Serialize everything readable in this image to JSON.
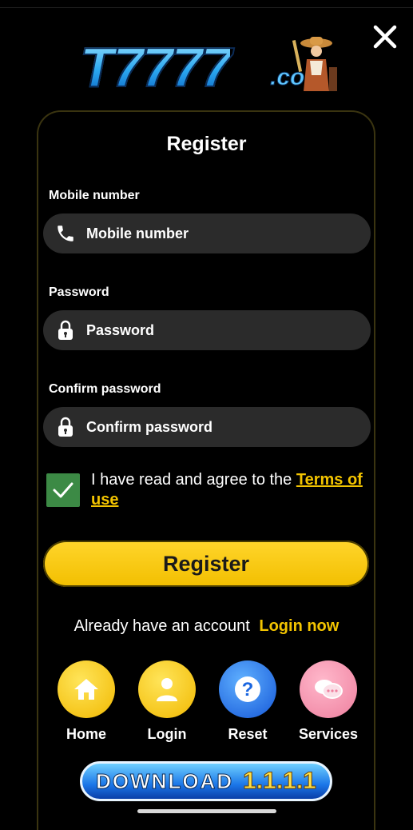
{
  "logo": {
    "main": "T7777",
    "suffix": ".com"
  },
  "form": {
    "title": "Register",
    "mobile": {
      "label": "Mobile number",
      "placeholder": "Mobile number"
    },
    "password": {
      "label": "Password",
      "placeholder": "Password"
    },
    "confirm": {
      "label": "Confirm password",
      "placeholder": "Confirm password"
    },
    "agree_text": "I have read and agree to the ",
    "terms_link": "Terms of use",
    "agree_checked": true,
    "submit_label": "Register"
  },
  "login_prompt": {
    "text": "Already have an account",
    "link": "Login now"
  },
  "nav": [
    {
      "label": "Home",
      "icon": "home-icon",
      "color": "#f3c400"
    },
    {
      "label": "Login",
      "icon": "user-icon",
      "color": "#f3c400"
    },
    {
      "label": "Reset",
      "icon": "question-icon",
      "color": "#1f7ff0"
    },
    {
      "label": "Services",
      "icon": "chat-bubbles-icon",
      "color": "#f59bb5"
    }
  ],
  "download": {
    "word": "DOWNLOAD",
    "version": "1.1.1.1"
  },
  "colors": {
    "accent": "#f3c400",
    "field_bg": "#2b2b2b",
    "checkbox": "#3c8a45"
  }
}
